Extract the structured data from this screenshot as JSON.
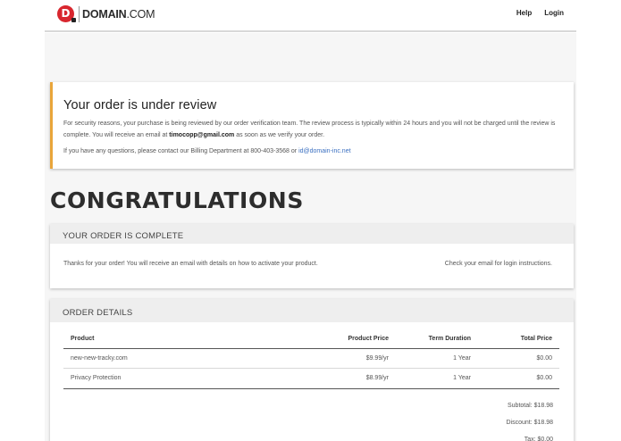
{
  "header": {
    "logo_letter": "D",
    "logo_name": "DOMAIN",
    "logo_tld": ".COM",
    "nav": {
      "help": "Help",
      "login": "Login"
    }
  },
  "review": {
    "title": "Your order is under review",
    "text_1": "For security reasons, your purchase is being reviewed by our order verification team. The review process is typically within 24 hours and you will not be charged until the review is complete. You will receive an email at",
    "email": "timocopp@gmail.com",
    "text_2": "as soon as we verify your order.",
    "question_text": "If you have any questions, please contact our Billing Department at 800-403-3568 or",
    "billing_email": "id@domain-inc.net"
  },
  "congrats": "CONGRATULATIONS",
  "complete": {
    "header": "YOUR ORDER IS COMPLETE",
    "left_text": "Thanks for your order! You will receive an email with details on how to activate your product.",
    "right_text": "Check your email for login instructions."
  },
  "details": {
    "header": "ORDER DETAILS",
    "columns": [
      "Product",
      "Product Price",
      "Term Duration",
      "Total Price"
    ],
    "rows": [
      [
        "new-new-tracky.com",
        "$9.99/yr",
        "1 Year",
        "$0.00"
      ],
      [
        "Privacy Protection",
        "$8.99/yr",
        "1 Year",
        "$0.00"
      ]
    ],
    "subtotal": "Subtotal: $18.98",
    "discount": "Discount: $18.98",
    "tax": "Tax: $0.00"
  },
  "colors": {
    "brand_red": "#d8262e",
    "review_accent": "#e9a53a",
    "link": "#3a6fc0"
  }
}
